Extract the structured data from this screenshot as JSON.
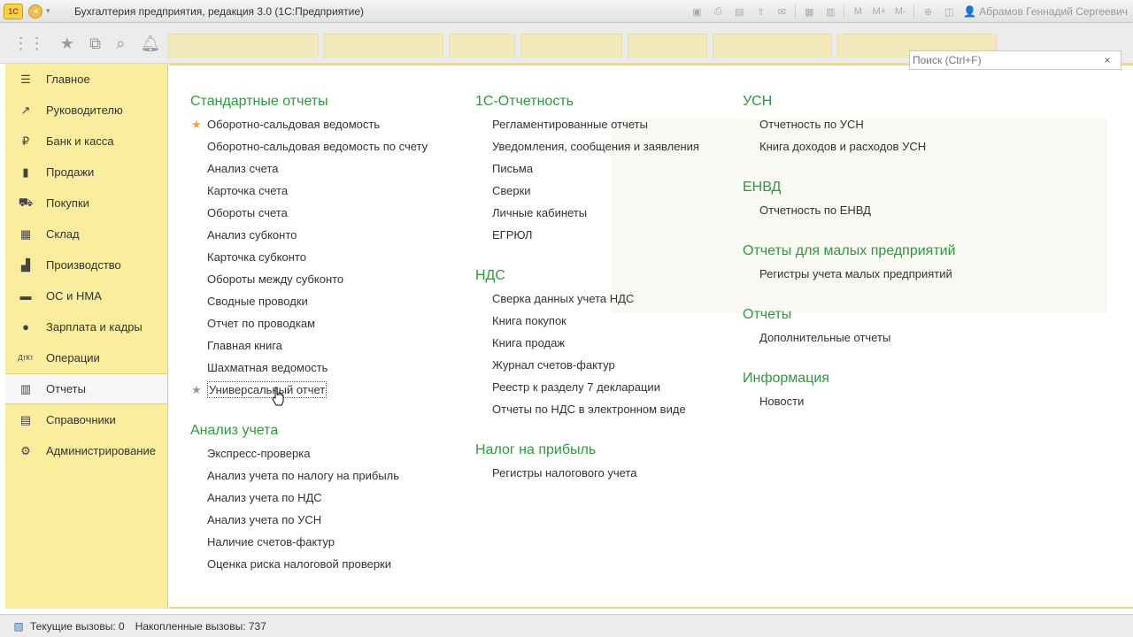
{
  "titlebar": {
    "logo": "1С",
    "title": "Бухгалтерия предприятия, редакция 3.0  (1С:Предприятие)",
    "user": "Абрамов Геннадий Сергеевич",
    "buttons": [
      "M",
      "M+",
      "M-"
    ]
  },
  "search": {
    "placeholder": "Поиск (Ctrl+F)",
    "clear": "×"
  },
  "sidebar": {
    "items": [
      {
        "label": "Главное",
        "icon": "menu-icon"
      },
      {
        "label": "Руководителю",
        "icon": "trend-up-icon"
      },
      {
        "label": "Банк и касса",
        "icon": "ruble-coin-icon"
      },
      {
        "label": "Продажи",
        "icon": "shopping-bag-icon"
      },
      {
        "label": "Покупки",
        "icon": "cart-icon"
      },
      {
        "label": "Склад",
        "icon": "warehouse-grid-icon"
      },
      {
        "label": "Производство",
        "icon": "factory-icon"
      },
      {
        "label": "ОС и НМА",
        "icon": "truck-icon"
      },
      {
        "label": "Зарплата и кадры",
        "icon": "people-icon"
      },
      {
        "label": "Операции",
        "icon": "debit-credit-icon"
      },
      {
        "label": "Отчеты",
        "icon": "bar-chart-icon",
        "active": true
      },
      {
        "label": "Справочники",
        "icon": "book-icon"
      },
      {
        "label": "Администрирование",
        "icon": "gear-icon"
      }
    ]
  },
  "columns": {
    "col1": {
      "standard": {
        "title": "Стандартные отчеты",
        "items": [
          "Оборотно-сальдовая ведомость",
          "Оборотно-сальдовая ведомость по счету",
          "Анализ счета",
          "Карточка счета",
          "Обороты счета",
          "Анализ субконто",
          "Карточка субконто",
          "Обороты между субконто",
          "Сводные проводки",
          "Отчет по проводкам",
          "Главная книга",
          "Шахматная ведомость",
          "Универсальный отчет"
        ]
      },
      "analysis": {
        "title": "Анализ учета",
        "items": [
          "Экспресс-проверка",
          "Анализ учета по налогу на прибыль",
          "Анализ учета по НДС",
          "Анализ учета по УСН",
          "Наличие счетов-фактур",
          "Оценка риска налоговой проверки"
        ]
      }
    },
    "col2": {
      "reporting": {
        "title": "1С-Отчетность",
        "items": [
          "Регламентированные отчеты",
          "Уведомления, сообщения и заявления",
          "Письма",
          "Сверки",
          "Личные кабинеты",
          "ЕГРЮЛ"
        ]
      },
      "vat": {
        "title": "НДС",
        "items": [
          "Сверка данных учета НДС",
          "Книга покупок",
          "Книга продаж",
          "Журнал счетов-фактур",
          "Реестр к разделу 7 декларации",
          "Отчеты по НДС в электронном виде"
        ]
      },
      "profit": {
        "title": "Налог на прибыль",
        "items": [
          "Регистры налогового учета"
        ]
      }
    },
    "col3": {
      "usn": {
        "title": "УСН",
        "items": [
          "Отчетность по УСН",
          "Книга доходов и расходов УСН"
        ]
      },
      "envd": {
        "title": "ЕНВД",
        "items": [
          "Отчетность по ЕНВД"
        ]
      },
      "small": {
        "title": "Отчеты для малых предприятий",
        "items": [
          "Регистры учета малых предприятий"
        ]
      },
      "reports": {
        "title": "Отчеты",
        "items": [
          "Дополнительные отчеты"
        ]
      },
      "info": {
        "title": "Информация",
        "items": [
          "Новости"
        ]
      }
    }
  },
  "statusbar": {
    "current_calls": "Текущие вызовы: 0",
    "accumulated_calls": "Накопленные вызовы: 737"
  },
  "colors": {
    "accent_green": "#2c9b3c",
    "sidebar_yellow": "#fbed9e",
    "favorite_star": "#f0a830"
  }
}
